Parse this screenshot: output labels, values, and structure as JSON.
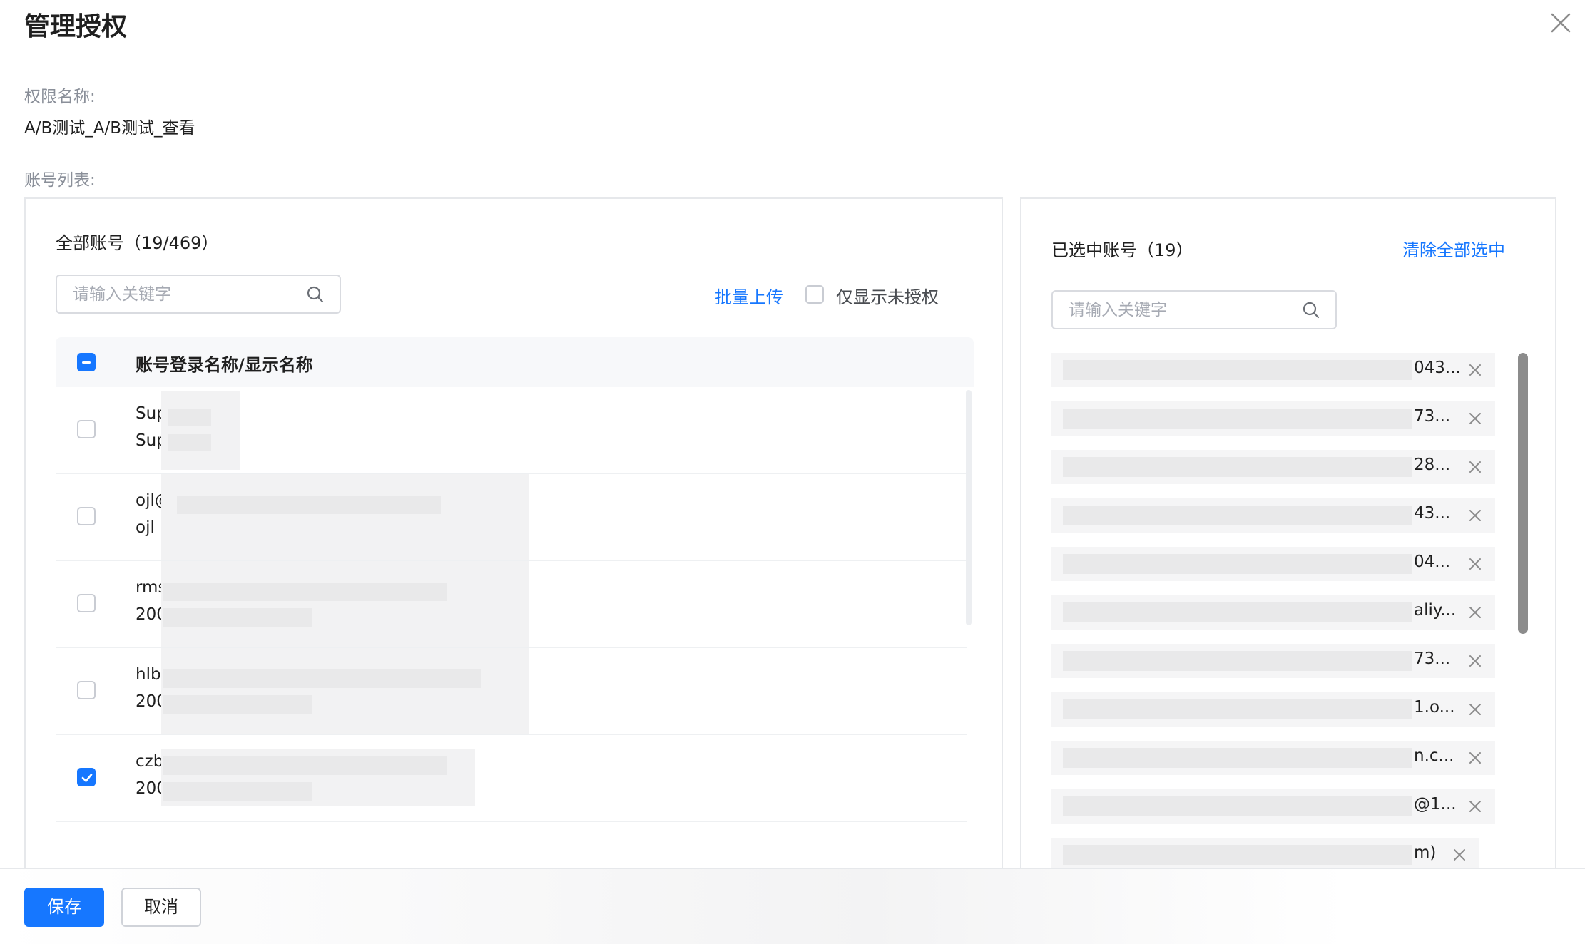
{
  "dialog": {
    "title": "管理授权",
    "close_icon": "close-icon"
  },
  "permission": {
    "label": "权限名称:",
    "value": "A/B测试_A/B测试_查看"
  },
  "accounts": {
    "label": "账号列表:"
  },
  "left_panel": {
    "title": "全部账号（19/469）",
    "search_placeholder": "请输入关键字",
    "batch_upload": "批量上传",
    "only_unauthorized": "仅显示未授权",
    "only_unauthorized_checked": false,
    "header_label": "账号登录名称/显示名称",
    "header_checkbox_state": "indeterminate",
    "rows": [
      {
        "line1": "Sup",
        "line2": "Sup",
        "checked": false
      },
      {
        "line1": "ojl@",
        "line2": "ojl",
        "checked": false
      },
      {
        "line1": "rms",
        "line2": "200",
        "checked": false
      },
      {
        "line1": "hlb",
        "line2": "200",
        "checked": false
      },
      {
        "line1": "czb",
        "line2": "200",
        "checked": true
      }
    ]
  },
  "right_panel": {
    "title": "已选中账号（19）",
    "clear_all": "清除全部选中",
    "search_placeholder": "请输入关键字",
    "items": [
      {
        "tail": "043..."
      },
      {
        "tail": "73..."
      },
      {
        "tail": "28..."
      },
      {
        "tail": "43..."
      },
      {
        "tail": "04..."
      },
      {
        "tail": "aliy..."
      },
      {
        "tail": "73..."
      },
      {
        "tail": "1.o..."
      },
      {
        "tail": "n.c..."
      },
      {
        "tail": "@1..."
      },
      {
        "tail": "m)"
      }
    ]
  },
  "footer": {
    "save": "保存",
    "cancel": "取消"
  },
  "colors": {
    "primary": "#1677ff",
    "border": "#e6e8eb",
    "muted_text": "#8a8f99"
  }
}
